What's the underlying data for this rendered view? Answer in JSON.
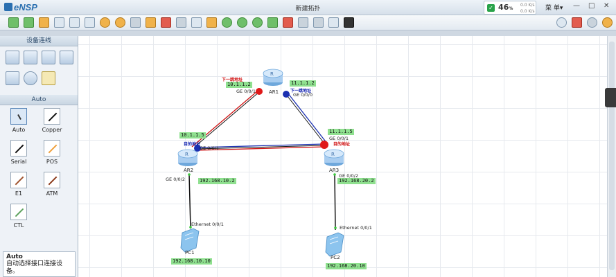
{
  "app": {
    "logo_text": "eNSP",
    "window_title": "新建拓扑",
    "status_value": "46",
    "status_unit": "%",
    "rate_up": "0.0 K/s",
    "rate_down": "0.0 K/s",
    "menu_label": "菜 单▾",
    "min_symbol": "—",
    "max_symbol": "□",
    "close_symbol": "✕"
  },
  "left_panel": {
    "devices_header": "设备连线",
    "auto_header": "Auto",
    "cables": [
      {
        "label": "Auto"
      },
      {
        "label": "Copper"
      },
      {
        "label": "Serial"
      },
      {
        "label": "POS"
      },
      {
        "label": "E1"
      },
      {
        "label": "ATM"
      },
      {
        "label": "CTL"
      }
    ],
    "info_title": "Auto",
    "info_desc": "自动选择接口连接设备。"
  },
  "topology": {
    "ar1": {
      "name": "AR1",
      "left_port": "GE 0/0/1",
      "right_port": "GE 0/0/0",
      "left_ip": "10.1.1.2",
      "right_ip": "11.1.1.2",
      "next_hop_red": "下一跳地址",
      "next_hop_blue": "下一跳地址"
    },
    "ar2": {
      "name": "AR2",
      "top_ip": "10.1.1.5",
      "top_port": "GE 0/0/1",
      "bottom_port": "GE 0/0/2",
      "bottom_ip": "192.168.10.2",
      "dest_note": "目的地址"
    },
    "ar3": {
      "name": "AR3",
      "top_ip": "11.1.1.5",
      "top_port": "GE 0/0/1",
      "bottom_port": "GE 0/0/2",
      "bottom_ip": "192.168.20.2",
      "dest_note": "目的地址"
    },
    "pc1": {
      "name": "PC1",
      "port": "Ethernet 0/0/1",
      "ip": "192.168.10.10"
    },
    "pc2": {
      "name": "PC2",
      "port": "Ethernet 0/0/1",
      "ip": "192.168.20.10"
    }
  },
  "colors": {
    "path_red": "#d01010",
    "path_blue": "#1a2fb0",
    "ip_label_bg": "#8fe08f"
  }
}
